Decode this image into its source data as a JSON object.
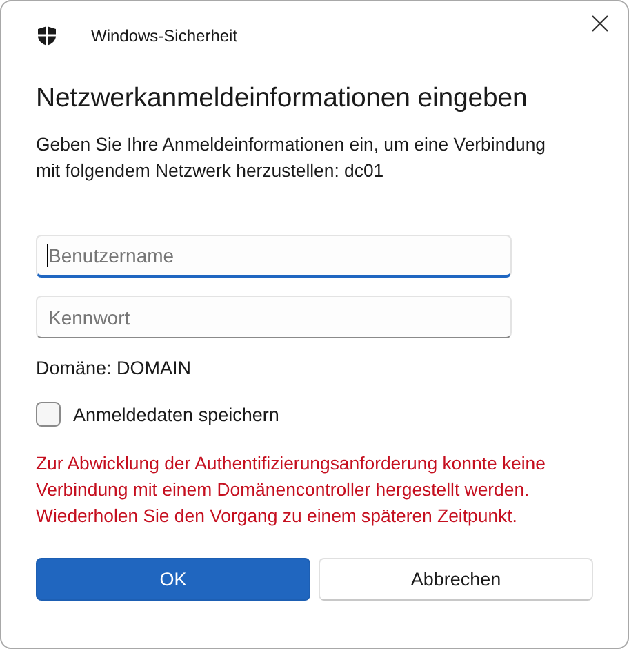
{
  "window": {
    "title": "Windows-Sicherheit"
  },
  "heading": "Netzwerkanmeldeinformationen eingeben",
  "description": "Geben Sie Ihre Anmeldeinformationen ein, um eine Verbindung mit folgendem Netzwerk herzustellen: dc01",
  "fields": [
    {
      "placeholder": "Benutzername",
      "focused": true
    },
    {
      "placeholder": "Kennwort",
      "focused": false
    }
  ],
  "domain": "Domäne: DOMAIN",
  "remember": {
    "label": "Anmeldedaten speichern",
    "checked": false
  },
  "error": "Zur Abwicklung der Authentifizierungsanforderung konnte keine Verbindung mit einem Domänencontroller hergestellt werden. Wiederholen Sie den Vorgang zu einem späteren Zeitpunkt.",
  "buttons": [
    {
      "label": "OK",
      "kind": "primary"
    },
    {
      "label": "Abbrechen",
      "kind": "secondary"
    }
  ]
}
